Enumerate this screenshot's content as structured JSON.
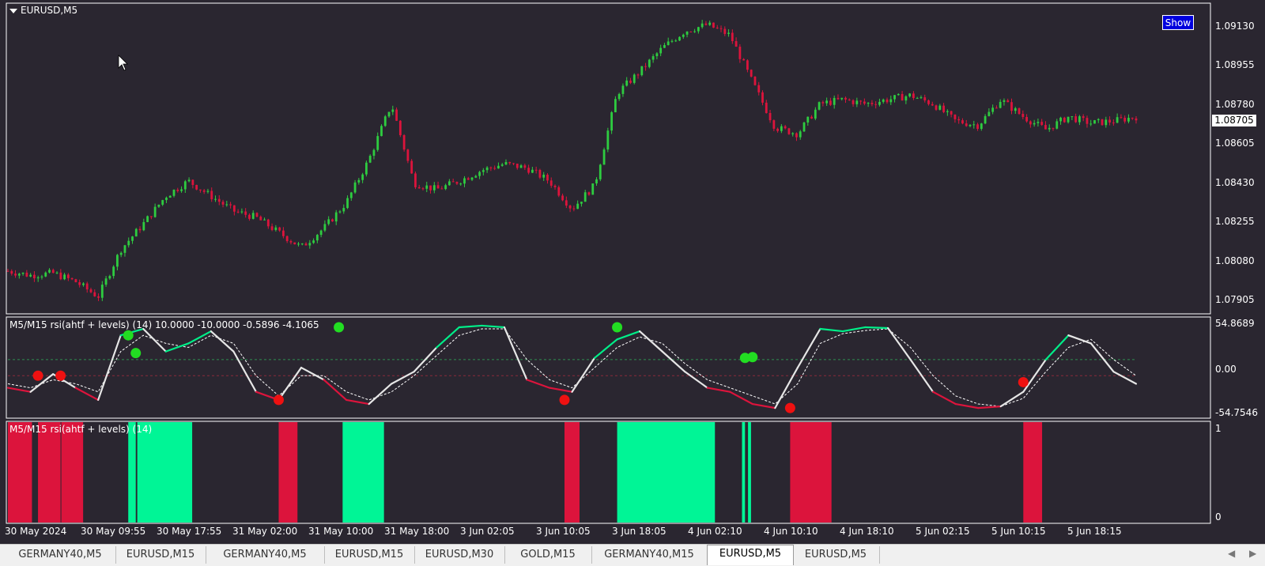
{
  "chart_data": [
    {
      "type": "line",
      "title": "EURUSD,M5",
      "price_ticks": [
        "1.09130",
        "1.08955",
        "1.08780",
        "1.08605",
        "1.08430",
        "1.08255",
        "1.08080",
        "1.07905"
      ],
      "current_price": "1.08705",
      "ylim": [
        1.078,
        1.0925
      ],
      "x": [
        0,
        3,
        6,
        9,
        12,
        15,
        18,
        21,
        24,
        27,
        30,
        33,
        36,
        39,
        42,
        45,
        48,
        51,
        54,
        57,
        60,
        63,
        66,
        69,
        72,
        75,
        78,
        81,
        84,
        87,
        90,
        93,
        96,
        99,
        102,
        105,
        108,
        111,
        114,
        117,
        120,
        123,
        126,
        129,
        132,
        135,
        138,
        141,
        144,
        147,
        150
      ],
      "close": [
        1.08,
        1.0798,
        1.0799,
        1.0795,
        1.0788,
        1.081,
        1.0822,
        1.0835,
        1.0842,
        1.0835,
        1.0828,
        1.0825,
        1.0818,
        1.0811,
        1.082,
        1.0832,
        1.0852,
        1.0878,
        1.0841,
        1.0838,
        1.0842,
        1.0847,
        1.085,
        1.0848,
        1.0842,
        1.0829,
        1.084,
        1.0883,
        1.0893,
        1.0904,
        1.0912,
        1.0915,
        1.091,
        1.0888,
        1.0867,
        1.0864,
        1.0878,
        1.088,
        1.0878,
        1.088,
        1.0882,
        1.0878,
        1.087,
        1.0868,
        1.088,
        1.0872,
        1.0866,
        1.0872,
        1.0869,
        1.087,
        1.0872
      ],
      "up_color": "#2ecc40",
      "down_color": "#dc143c",
      "show_button": "Show"
    },
    {
      "type": "line",
      "title": "M5/M15 rsi(ahtf + levels) (14) 10.0000 -10.0000 -0.5896 -4.1065",
      "y_ticks": [
        "54.8689",
        "0.00",
        "-54.7546"
      ],
      "ylim": [
        -54.7546,
        54.8689
      ],
      "levels": [
        10,
        -10
      ],
      "x": [
        0,
        3,
        6,
        9,
        12,
        15,
        18,
        21,
        24,
        27,
        30,
        33,
        36,
        39,
        42,
        45,
        48,
        51,
        54,
        57,
        60,
        63,
        66,
        69,
        72,
        75,
        78,
        81,
        84,
        87,
        90,
        93,
        96,
        99,
        102,
        105,
        108,
        111,
        114,
        117,
        120,
        123,
        126,
        129,
        132,
        135,
        138,
        141,
        144,
        147,
        150
      ],
      "rsi": [
        -25,
        -30,
        -8,
        -25,
        -40,
        40,
        48,
        20,
        30,
        45,
        20,
        -30,
        -40,
        0,
        -15,
        -40,
        -45,
        -20,
        -5,
        25,
        50,
        52,
        50,
        -15,
        -25,
        -30,
        12,
        35,
        45,
        20,
        -5,
        -25,
        -30,
        -45,
        -50,
        0,
        48,
        45,
        50,
        49,
        10,
        -30,
        -45,
        -50,
        -48,
        -30,
        10,
        40,
        30,
        -5,
        -20
      ],
      "signal": [
        -20,
        -25,
        -15,
        -20,
        -30,
        20,
        40,
        30,
        25,
        40,
        30,
        -10,
        -35,
        -10,
        -10,
        -30,
        -40,
        -30,
        -10,
        15,
        40,
        48,
        48,
        10,
        -15,
        -25,
        0,
        25,
        38,
        30,
        5,
        -15,
        -25,
        -35,
        -45,
        -20,
        30,
        42,
        46,
        48,
        25,
        -10,
        -35,
        -45,
        -48,
        -38,
        -5,
        25,
        35,
        10,
        -10
      ],
      "up_dots": [
        [
          16,
          40
        ],
        [
          17,
          18
        ],
        [
          44,
          50
        ],
        [
          81,
          50
        ],
        [
          98,
          12
        ],
        [
          99,
          13
        ]
      ],
      "down_dots": [
        [
          4,
          -10
        ],
        [
          7,
          -10
        ],
        [
          36,
          -40
        ],
        [
          74,
          -40
        ],
        [
          104,
          -50
        ],
        [
          135,
          -18
        ]
      ],
      "line_color": "#e6e6e6",
      "up_color": "#00ee88",
      "down_color": "#dc143c"
    },
    {
      "type": "bar",
      "title": "M5/M15 rsi(ahtf + levels) (14)",
      "y_ticks": [
        "1",
        "0"
      ],
      "segments": [
        {
          "from": 0,
          "to": 3.2,
          "state": "down"
        },
        {
          "from": 4,
          "to": 7,
          "state": "down"
        },
        {
          "from": 7.1,
          "to": 10,
          "state": "down"
        },
        {
          "from": 16,
          "to": 17,
          "state": "up"
        },
        {
          "from": 17.2,
          "to": 24.5,
          "state": "up"
        },
        {
          "from": 36,
          "to": 38.5,
          "state": "down"
        },
        {
          "from": 44.5,
          "to": 50,
          "state": "up"
        },
        {
          "from": 74,
          "to": 76,
          "state": "down"
        },
        {
          "from": 81,
          "to": 94,
          "state": "up"
        },
        {
          "from": 97.6,
          "to": 98,
          "state": "up"
        },
        {
          "from": 98.4,
          "to": 98.8,
          "state": "up"
        },
        {
          "from": 104,
          "to": 109.5,
          "state": "down"
        },
        {
          "from": 135,
          "to": 137.5,
          "state": "down"
        }
      ],
      "x_total": 160,
      "up_color": "#00f596",
      "down_color": "#dc143c"
    }
  ],
  "time_labels": [
    "30 May 2024",
    "30 May 09:55",
    "30 May 17:55",
    "31 May 02:00",
    "31 May 10:00",
    "31 May 18:00",
    "3 Jun 02:05",
    "3 Jun 10:05",
    "3 Jun 18:05",
    "4 Jun 02:10",
    "4 Jun 10:10",
    "4 Jun 18:10",
    "5 Jun 02:15",
    "5 Jun 10:15",
    "5 Jun 18:15"
  ],
  "tabs": [
    "GERMANY40,M5",
    "EURUSD,M15",
    "GERMANY40,M5",
    "EURUSD,M15",
    "EURUSD,M30",
    "GOLD,M15",
    "GERMANY40,M15",
    "EURUSD,M5",
    "EURUSD,M5"
  ],
  "active_tab": 7,
  "colors": {
    "background": "#2a2630",
    "frame": "#ffffff",
    "text": "#ffffff"
  }
}
